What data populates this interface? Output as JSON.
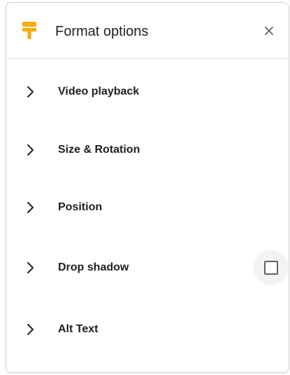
{
  "panel": {
    "title": "Format options",
    "title_icon": "format-paint-icon",
    "close_icon": "close-icon",
    "accent_color": "#f9ab00"
  },
  "sections": [
    {
      "label": "Video playback",
      "expanded": false
    },
    {
      "label": "Size & Rotation",
      "expanded": false
    },
    {
      "label": "Position",
      "expanded": false
    },
    {
      "label": "Drop shadow",
      "expanded": false,
      "checkbox": {
        "checked": false
      }
    },
    {
      "label": "Alt Text",
      "expanded": false
    }
  ]
}
